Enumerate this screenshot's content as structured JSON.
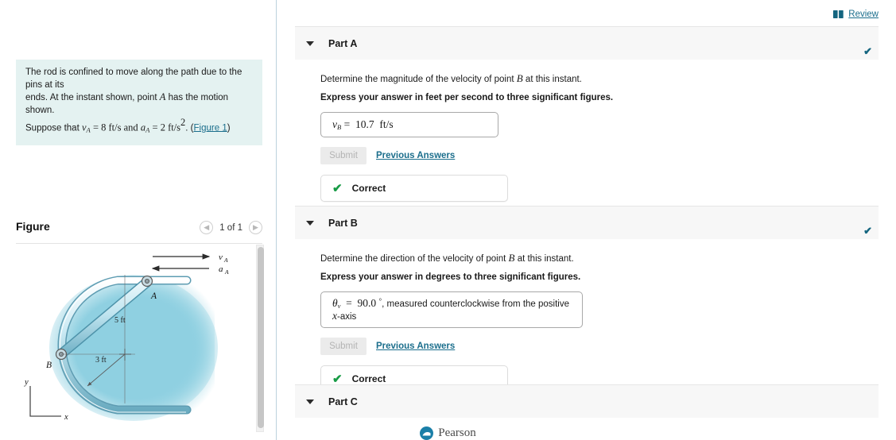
{
  "left": {
    "problem": {
      "line1": "The rod is confined to move along the path due to the pins at its",
      "line2_a": "ends. At the instant shown, point",
      "line2_var": "A",
      "line2_b": "has the motion shown.",
      "line3_a": "Suppose that",
      "line3_v": "v",
      "line3_v_sub": "A",
      "line3_eq1": "= 8 ft/s and",
      "line3_a2": "a",
      "line3_a2_sub": "A",
      "line3_eq2": "= 2 ft/s",
      "line3_exp": "2",
      "line3_end": ". (",
      "figure_link": "Figure 1",
      "line3_close": ")"
    },
    "figure": {
      "title": "Figure",
      "prev_icon": "chevron-left-icon",
      "next_icon": "chevron-right-icon",
      "counter": "1 of 1",
      "labels": {
        "point_a": "A",
        "point_b": "B",
        "len_ab": "5 ft",
        "radius": "3 ft",
        "vel_arrow": "v",
        "vel_arrow_sub": "A",
        "acc_arrow": "a",
        "acc_arrow_sub": "A",
        "axis_y": "y",
        "axis_x": "x"
      },
      "colors": {
        "shade": "#8ecfe0",
        "rod": "#bfe4ef",
        "rod_edge": "#5f9fb4"
      }
    }
  },
  "header": {
    "review_icon": "book-icon",
    "review_label": "Review",
    "review_color": "#1b6e8c"
  },
  "parts": [
    {
      "label": "Part A",
      "caret_icon": "caret-down-icon",
      "status_check_icon": "check-icon",
      "question_pre": "Determine the magnitude of the velocity of point",
      "question_var": "B",
      "question_post": "at this instant.",
      "instruction": "Express your answer in feet per second to three significant figures.",
      "answer": {
        "symbol": "v",
        "symbol_sub": "B",
        "equals": "=",
        "value": "10.7",
        "units": "ft/s",
        "trailing": ""
      },
      "submit_label": "Submit",
      "previous_label": "Previous Answers",
      "status_label": "Correct",
      "status_color": "#179b45"
    },
    {
      "label": "Part B",
      "caret_icon": "caret-down-icon",
      "status_check_icon": "check-icon",
      "question_pre": "Determine the direction of the velocity of point",
      "question_var": "B",
      "question_post": "at this instant.",
      "instruction": "Express your answer in degrees to three significant figures.",
      "answer": {
        "symbol": "θ",
        "symbol_sub": "v",
        "equals": "=",
        "value": "90.0",
        "units": "°",
        "trailing_a": ", measured counterclockwise from the positive",
        "trailing_var": "x",
        "trailing_b": "-axis"
      },
      "submit_label": "Submit",
      "previous_label": "Previous Answers",
      "status_label": "Correct",
      "status_color": "#179b45"
    },
    {
      "label": "Part C",
      "caret_icon": "caret-down-icon"
    }
  ],
  "footer": {
    "logo_icon": "pearson-logo-icon",
    "brand": "Pearson",
    "brand_color": "#1a7fa8"
  }
}
